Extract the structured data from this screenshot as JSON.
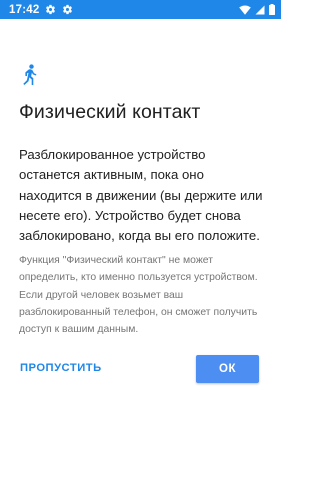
{
  "status_bar": {
    "time": "17:42",
    "icons": [
      "gear-icon",
      "gear-icon",
      "wifi-icon",
      "signal-icon",
      "battery-icon"
    ],
    "color": "#1e87e8"
  },
  "page": {
    "icon": "walking-person-icon",
    "title": "Физический контакт",
    "body": "Разблокированное устройство останется активным, пока оно находится в движении (вы держите или несете его). Устройство будет снова заблокировано, когда вы его положите.",
    "note": "Функция \"Физический контакт\" не может определить, кто именно пользуется устройством. Если другой человек возьмет ваш разблокированный телефон, он сможет получить доступ к вашим данным."
  },
  "actions": {
    "skip_label": "ПРОПУСТИТЬ",
    "ok_label": "ОК",
    "accent": "#4c8ef2"
  }
}
